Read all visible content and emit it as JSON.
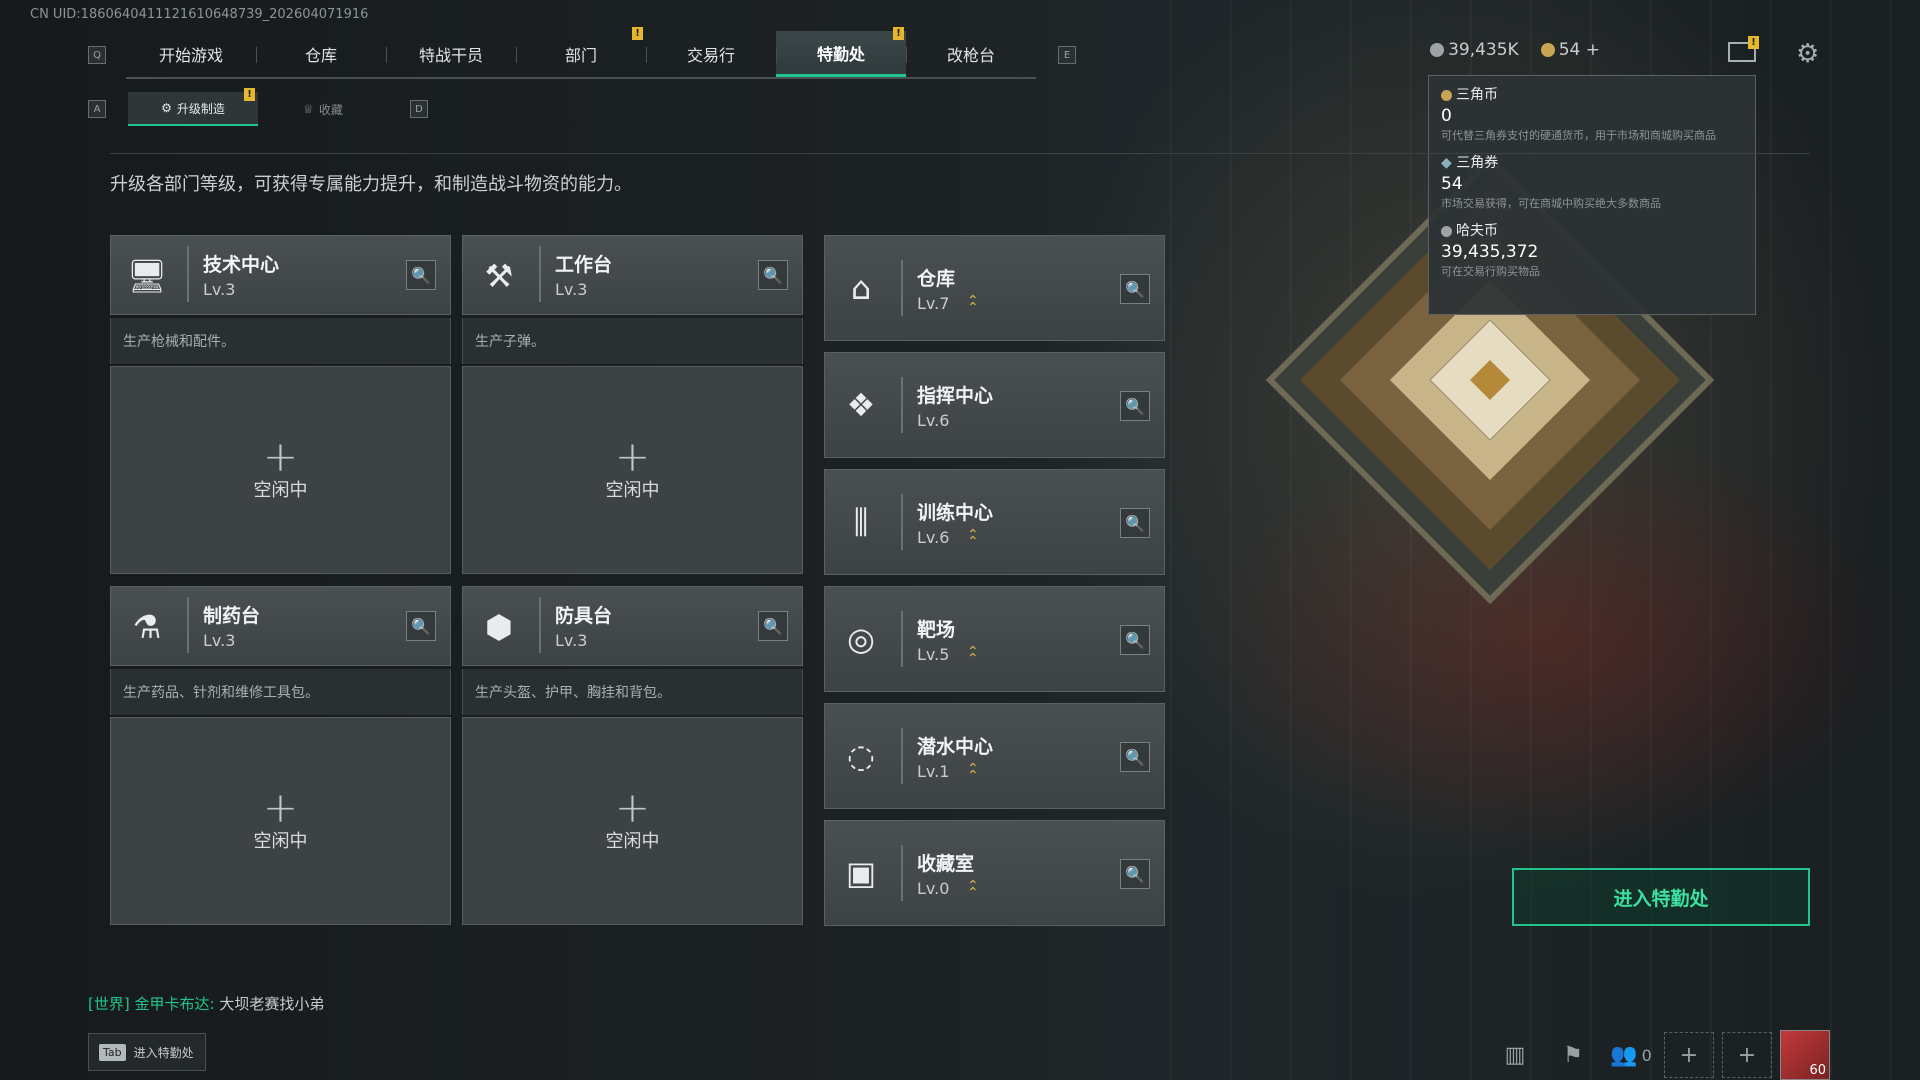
{
  "uid": "CN UID:1860640411121610648739_202604071916",
  "tabs": {
    "key_left": "Q",
    "key_right": "E",
    "items": [
      "开始游戏",
      "仓库",
      "特战干员",
      "部门",
      "交易行",
      "特勤处",
      "改枪台"
    ],
    "active": "特勤处"
  },
  "subtabs": {
    "key_left": "A",
    "key_right": "D",
    "items": [
      "升级制造",
      "收藏"
    ],
    "active": "升级制造"
  },
  "currency": {
    "hafu_short": "39,435K",
    "triangle_short": "54 +"
  },
  "tooltip": [
    {
      "name": "三角币",
      "value": "0",
      "desc": "可代替三角券支付的硬通货币，用于市场和商城购买商品"
    },
    {
      "name": "三角券",
      "value": "54",
      "desc": "市场交易获得，可在商城中购买绝大多数商品"
    },
    {
      "name": "哈夫币",
      "value": "39,435,372",
      "desc": "可在交易行购买物品"
    }
  ],
  "intro": "升级各部门等级，可获得专属能力提升，和制造战斗物资的能力。",
  "work_stations": [
    {
      "name": "技术中心",
      "level": "Lv.3",
      "desc": "生产枪械和配件。",
      "slot": "空闲中",
      "icon": "tech-center-icon"
    },
    {
      "name": "工作台",
      "level": "Lv.3",
      "desc": "生产子弹。",
      "slot": "空闲中",
      "icon": "workbench-icon"
    },
    {
      "name": "制药台",
      "level": "Lv.3",
      "desc": "生产药品、针剂和维修工具包。",
      "slot": "空闲中",
      "icon": "pharmacy-icon"
    },
    {
      "name": "防具台",
      "level": "Lv.3",
      "desc": "生产头盔、护甲、胸挂和背包。",
      "slot": "空闲中",
      "icon": "armor-bench-icon"
    }
  ],
  "departments": [
    {
      "name": "仓库",
      "level": "Lv.7",
      "upgradable": true,
      "icon": "warehouse-icon"
    },
    {
      "name": "指挥中心",
      "level": "Lv.6",
      "upgradable": false,
      "icon": "command-center-icon"
    },
    {
      "name": "训练中心",
      "level": "Lv.6",
      "upgradable": true,
      "icon": "training-center-icon"
    },
    {
      "name": "靶场",
      "level": "Lv.5",
      "upgradable": true,
      "icon": "shooting-range-icon"
    },
    {
      "name": "潜水中心",
      "level": "Lv.1",
      "upgradable": true,
      "icon": "diving-center-icon"
    },
    {
      "name": "收藏室",
      "level": "Lv.0",
      "upgradable": true,
      "icon": "collection-room-icon"
    }
  ],
  "enter_button": "进入特勤处",
  "chat": {
    "channel": "[世界]",
    "user": "金甲卡布达:",
    "message": "大坝老赛找小弟"
  },
  "tab_hint": {
    "key": "Tab",
    "label": "进入特勤处"
  },
  "friends_count": "0",
  "player_level": "60",
  "colors": {
    "accent": "#21c48a",
    "warning": "#e4b72c",
    "upgrade": "#d7b14a"
  }
}
